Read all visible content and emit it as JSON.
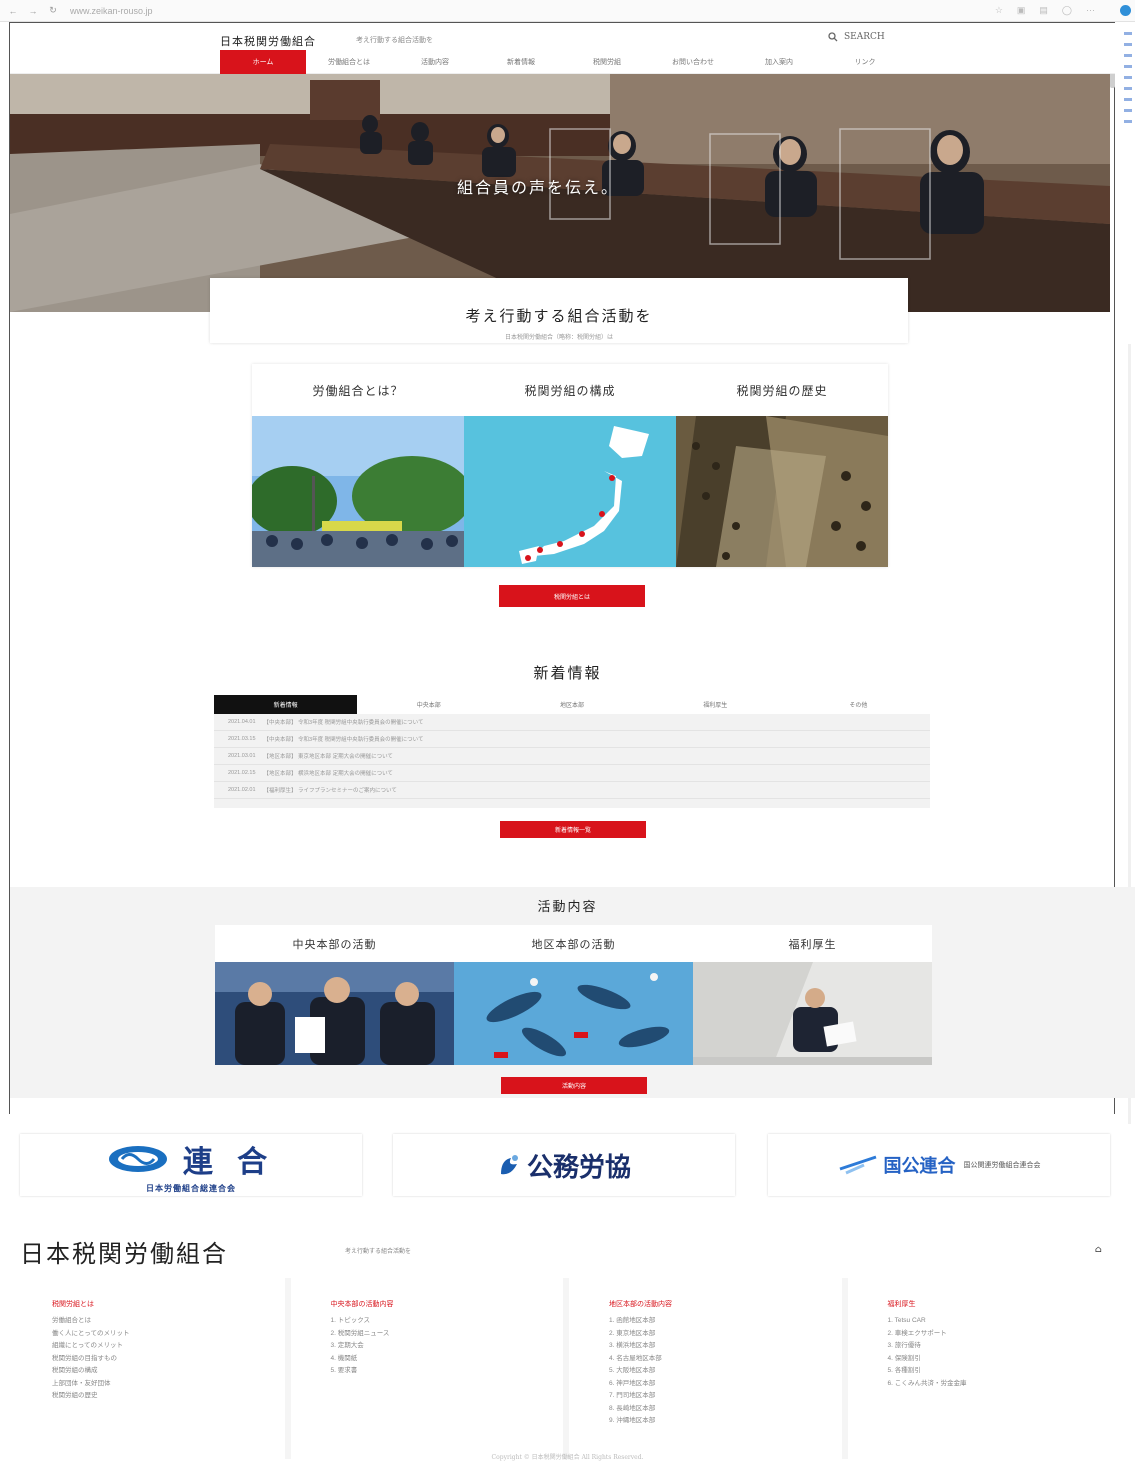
{
  "browser": {
    "url": "www.zeikan-rouso.jp"
  },
  "header": {
    "logo_text": "日本税関労働組合",
    "tagline": "考え行動する組合活動を",
    "search_label": "SEARCH"
  },
  "nav": {
    "items": [
      "ホーム",
      "労働組合とは",
      "活動内容",
      "新着情報",
      "税関労組",
      "お問い合わせ",
      "加入案内",
      "リンク"
    ],
    "active_index": 0
  },
  "hero": {
    "caption": "組合員の声を伝え。",
    "box_title": "考え行動する組合活動を",
    "box_subtitle": "日本税関労働組合（略称：税関労組）は"
  },
  "about": {
    "cards": [
      "労働組合とは？",
      "税関労組の構成",
      "税関労組の歴史"
    ],
    "button": "税関労組とは"
  },
  "news": {
    "title": "新着情報",
    "tabs": [
      "新着情報",
      "中央本部",
      "地区本部",
      "福利厚生",
      "その他"
    ],
    "rows": [
      {
        "date": "2021.04.01",
        "text": "【中央本部】 令和3年度 税関労組中央執行委員会の開催について"
      },
      {
        "date": "2021.03.15",
        "text": "【中央本部】 令和3年度 税関労組中央執行委員会の開催について"
      },
      {
        "date": "2021.03.01",
        "text": "【地区本部】 東京地区本部 定期大会の開催について"
      },
      {
        "date": "2021.02.15",
        "text": "【地区本部】 横浜地区本部 定期大会の開催について"
      },
      {
        "date": "2021.02.01",
        "text": "【福利厚生】 ライフプランセミナーのご案内について"
      }
    ],
    "button": "新着情報一覧"
  },
  "activity": {
    "title": "活動内容",
    "cards": [
      "中央本部の活動",
      "地区本部の活動",
      "福利厚生"
    ],
    "button": "活動内容"
  },
  "banners": {
    "rengo": {
      "name": "連 合",
      "sub": "日本労働組合総連合会"
    },
    "komu": {
      "name": "公務労協"
    },
    "kokko": {
      "name": "国公連合",
      "sub": "国公関連労働組合連合会"
    }
  },
  "footer": {
    "title": "日本税関労働組合",
    "subtitle": "考え行動する組合活動を",
    "columns": [
      {
        "heading": "税関労組とは",
        "items": [
          "労働組合とは",
          "働く人にとってのメリット",
          "組織にとってのメリット",
          "税関労組の目指すもの",
          "税関労組の構成",
          "上部団体・友好団体",
          "税関労組の歴史"
        ]
      },
      {
        "heading": "中央本部の活動内容",
        "items": [
          "1. トピックス",
          "2. 税関労組ニュース",
          "3. 定期大会",
          "4. 機関紙",
          "5. 要求書"
        ]
      },
      {
        "heading": "地区本部の活動内容",
        "items": [
          "1. 函館地区本部",
          "2. 東京地区本部",
          "3. 横浜地区本部",
          "4. 名古屋地区本部",
          "5. 大阪地区本部",
          "6. 神戸地区本部",
          "7. 門司地区本部",
          "8. 長崎地区本部",
          "9. 沖縄地区本部"
        ]
      },
      {
        "heading": "福利厚生",
        "items": [
          "1. Tetsu CAR",
          "2. 車検エクサポート",
          "3. 旅行優待",
          "4. 保険割引",
          "5. 各種割引",
          "6. こくみん共済・労金金庫"
        ]
      }
    ],
    "copyright": "Copyright © 日本税関労働組合 All Rights Reserved."
  },
  "colors": {
    "accent": "#d8131b"
  }
}
